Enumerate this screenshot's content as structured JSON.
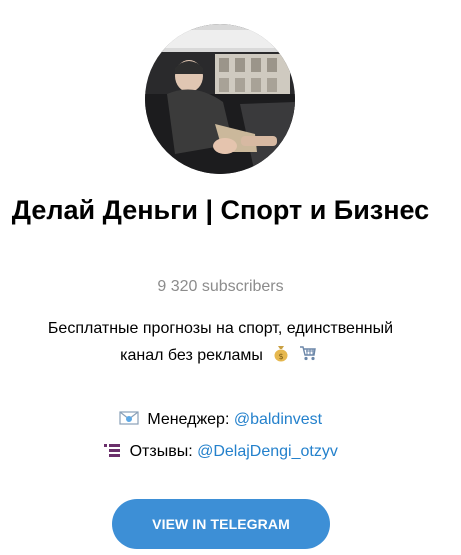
{
  "channel": {
    "title": "Делай Деньги | Спорт и Бизнес",
    "subscribers": "9 320 subscribers",
    "description_line1": "Бесплатные прогнозы на спорт, единственный",
    "description_line2": "канал без рекламы",
    "description_emojis": [
      "money-bag-icon",
      "shopping-cart-icon"
    ]
  },
  "contacts": {
    "manager_label": "Менеджер: ",
    "manager_handle": "@baldinvest",
    "manager_icon": "envelope-icon",
    "reviews_label": "Отзывы: ",
    "reviews_handle": "@DelajDengi_otzyv",
    "reviews_icon": "list-icon"
  },
  "actions": {
    "view_button": "VIEW IN TELEGRAM"
  },
  "colors": {
    "link": "#2481cc",
    "button": "#3d8fd6",
    "muted_text": "#8c8c8c"
  }
}
